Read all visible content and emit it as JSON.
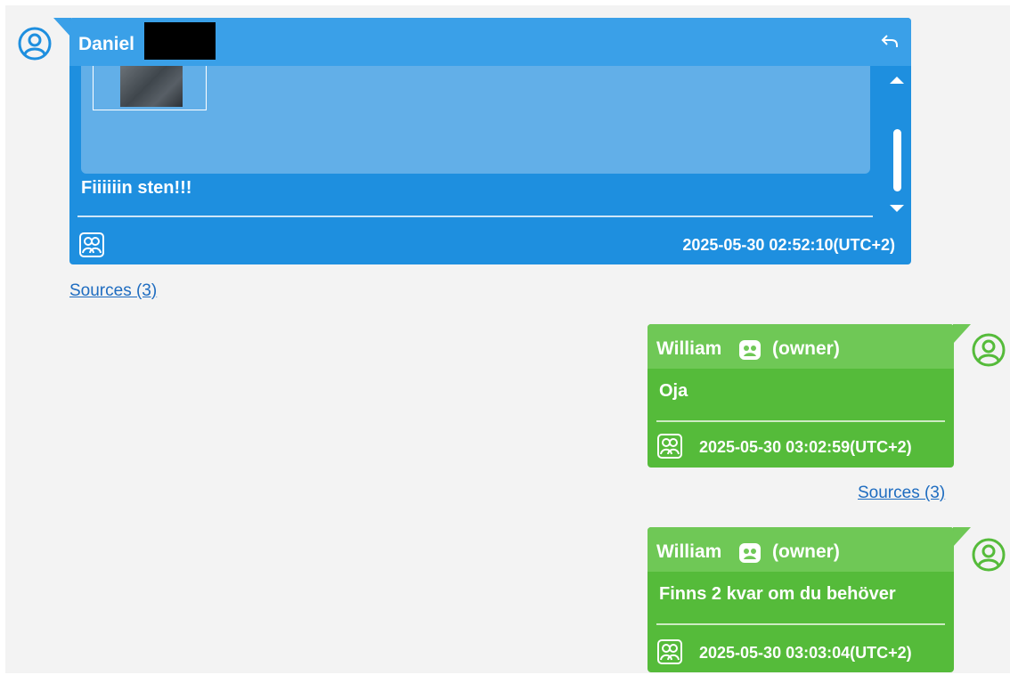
{
  "colors": {
    "incoming_bubble": "#1e8fdf",
    "incoming_header": "#3aa0e8",
    "outgoing_bubble": "#55bb3a",
    "outgoing_header": "#6fc856",
    "link": "#1e6cc0",
    "background": "#f3f3f3"
  },
  "messages": [
    {
      "direction": "incoming",
      "sender": "Daniel",
      "sender_redacted": true,
      "avatar_icon": "user-avatar-icon",
      "attachment": "image",
      "text": "Fiiiiiin sten!!!",
      "timestamp": "2025-05-30 02:52:10(UTC+2)",
      "sources_label": "Sources (3)"
    },
    {
      "direction": "outgoing",
      "sender": "William",
      "role": "(owner)",
      "avatar_icon": "user-avatar-icon",
      "text": "Oja",
      "timestamp": "2025-05-30 03:02:59(UTC+2)",
      "sources_label": "Sources (3)"
    },
    {
      "direction": "outgoing",
      "sender": "William",
      "role": "(owner)",
      "avatar_icon": "user-avatar-icon",
      "text": "Finns 2 kvar om du behöver",
      "timestamp": "2025-05-30 03:03:04(UTC+2)"
    }
  ]
}
